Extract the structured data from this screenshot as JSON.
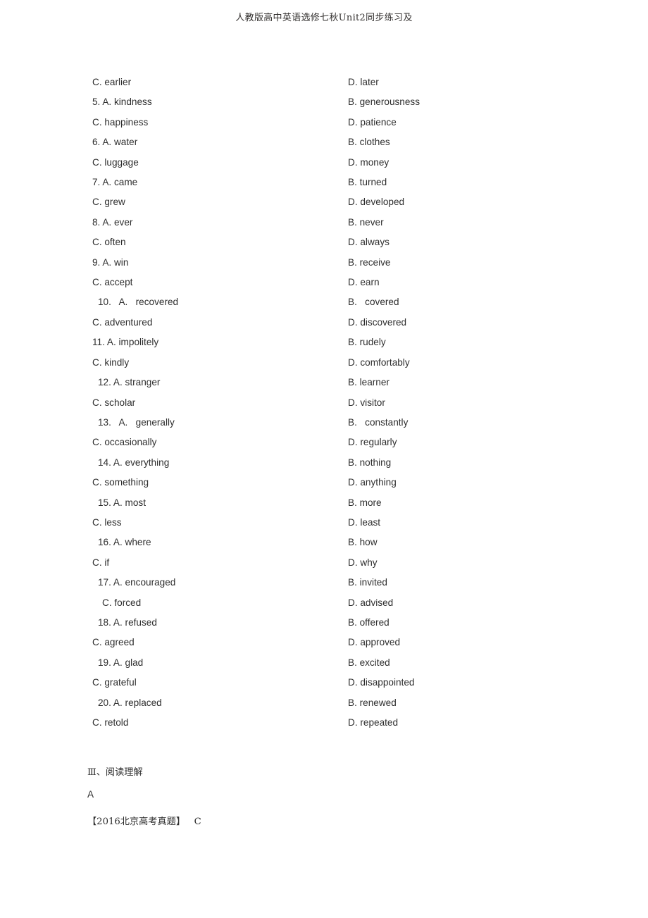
{
  "header": {
    "text": "人教版高中英语选修七秋Unit2同步练习及"
  },
  "cloze_options": {
    "rows": [
      {
        "left": "C. earlier",
        "left_indent": 0,
        "right": "D. later"
      },
      {
        "left": "5. A. kindness",
        "left_indent": 0,
        "right": "B. generousness"
      },
      {
        "left": "C. happiness",
        "left_indent": 0,
        "right": "D. patience"
      },
      {
        "left": "6. A. water",
        "left_indent": 0,
        "right": "B. clothes"
      },
      {
        "left": "C. luggage",
        "left_indent": 0,
        "right": "D. money"
      },
      {
        "left": "7. A. came",
        "left_indent": 0,
        "right": "B. turned"
      },
      {
        "left": "C. grew",
        "left_indent": 0,
        "right": "D. developed"
      },
      {
        "left": "8. A. ever",
        "left_indent": 0,
        "right": "B. never"
      },
      {
        "left": "C. often",
        "left_indent": 0,
        "right": "D. always"
      },
      {
        "left": "9. A. win",
        "left_indent": 0,
        "right": "B. receive"
      },
      {
        "left": "C. accept",
        "left_indent": 0,
        "right": "D. earn"
      },
      {
        "left": "10.   A.   recovered",
        "left_indent": 1,
        "right": "B.   covered"
      },
      {
        "left": "C. adventured",
        "left_indent": 0,
        "right": "D. discovered"
      },
      {
        "left": "11. A. impolitely",
        "left_indent": 0,
        "right": "B. rudely"
      },
      {
        "left": "C. kindly",
        "left_indent": 0,
        "right": "D. comfortably"
      },
      {
        "left": "12. A. stranger",
        "left_indent": 1,
        "right": "B. learner"
      },
      {
        "left": "C. scholar",
        "left_indent": 0,
        "right": "D. visitor"
      },
      {
        "left": "13.   A.   generally",
        "left_indent": 1,
        "right": "B.   constantly"
      },
      {
        "left": "C. occasionally",
        "left_indent": 0,
        "right": "D. regularly"
      },
      {
        "left": "14. A. everything",
        "left_indent": 1,
        "right": "B. nothing"
      },
      {
        "left": "C. something",
        "left_indent": 0,
        "right": "D. anything"
      },
      {
        "left": "15. A. most",
        "left_indent": 1,
        "right": "B. more"
      },
      {
        "left": "C. less",
        "left_indent": 0,
        "right": "D. least"
      },
      {
        "left": "16. A. where",
        "left_indent": 1,
        "right": "B. how"
      },
      {
        "left": "C. if",
        "left_indent": 0,
        "right": "D. why"
      },
      {
        "left": "17. A. encouraged",
        "left_indent": 1,
        "right": "B. invited"
      },
      {
        "left": "C. forced",
        "left_indent": 2,
        "right": "D. advised"
      },
      {
        "left": "18. A. refused",
        "left_indent": 1,
        "right": "B. offered"
      },
      {
        "left": "C. agreed",
        "left_indent": 0,
        "right": "D. approved"
      },
      {
        "left": "19. A. glad",
        "left_indent": 1,
        "right": "B. excited"
      },
      {
        "left": "C. grateful",
        "left_indent": 0,
        "right": "D. disappointed"
      },
      {
        "left": "20. A. replaced",
        "left_indent": 1,
        "right": "B. renewed"
      },
      {
        "left": "C. retold",
        "left_indent": 0,
        "right": "D. repeated"
      }
    ]
  },
  "reading_section": {
    "heading": "Ⅲ、阅读理解",
    "passage_label": "A",
    "source_note": "【2016北京高考真题】   C"
  }
}
